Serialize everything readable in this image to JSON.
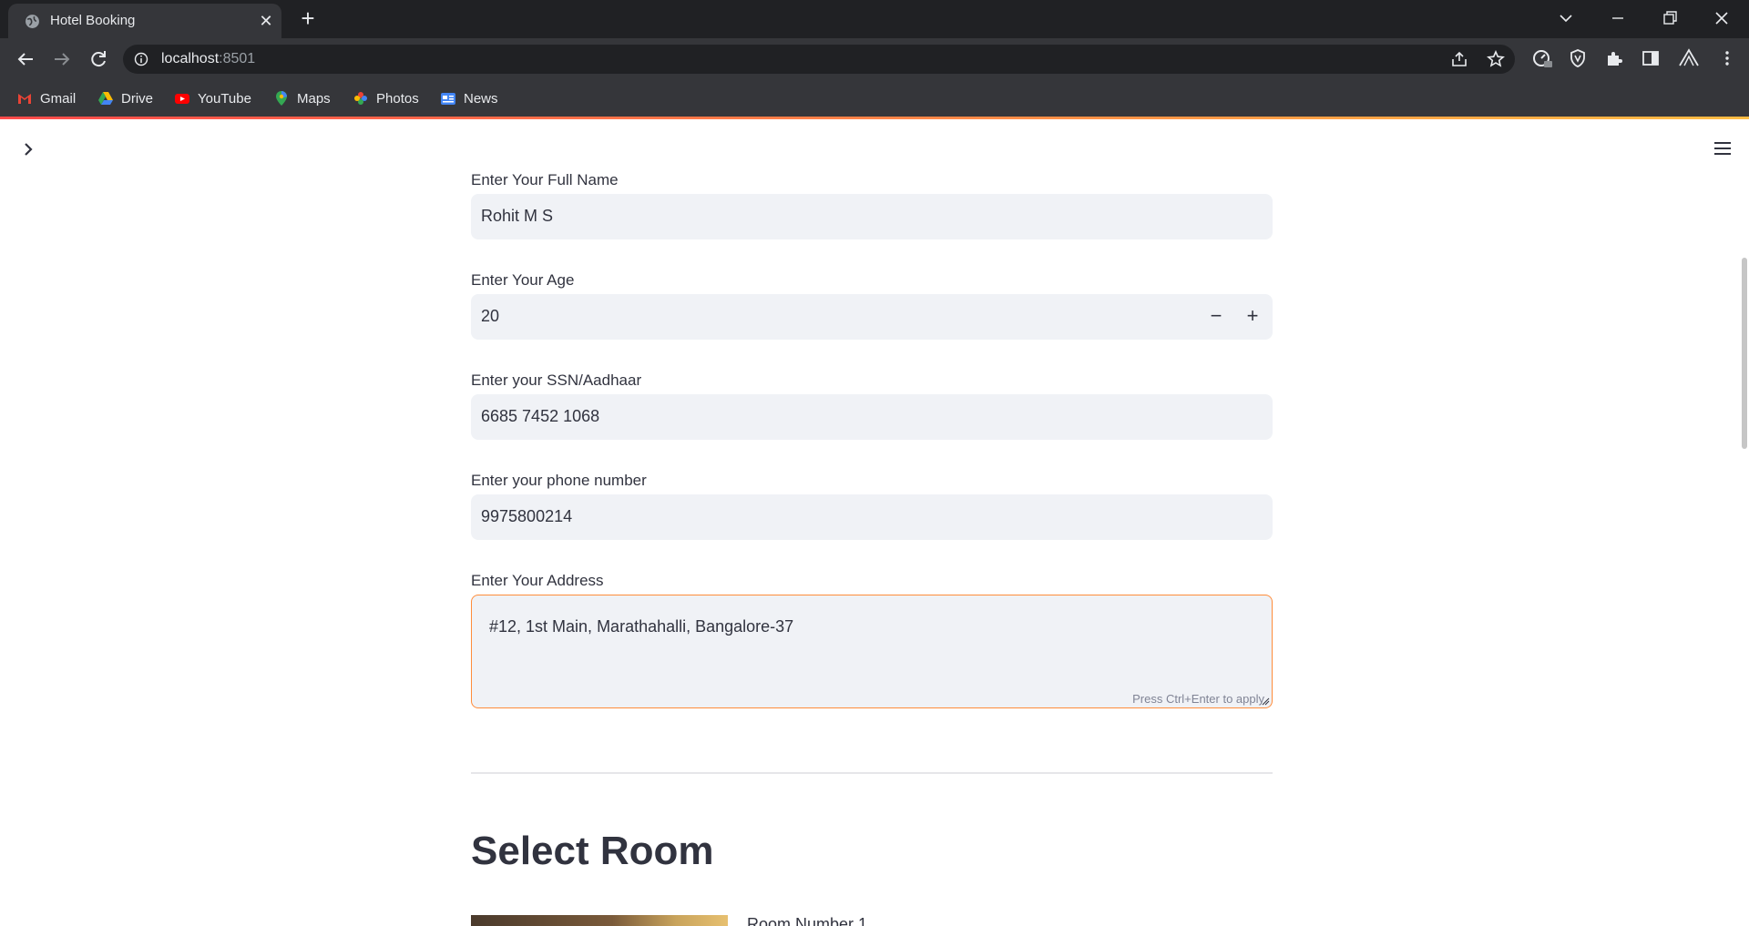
{
  "browser": {
    "tab_title": "Hotel Booking",
    "url_host": "localhost",
    "url_port": ":8501",
    "bookmarks": [
      {
        "label": "Gmail",
        "icon": "gmail-icon"
      },
      {
        "label": "Drive",
        "icon": "drive-icon"
      },
      {
        "label": "YouTube",
        "icon": "youtube-icon"
      },
      {
        "label": "Maps",
        "icon": "maps-icon"
      },
      {
        "label": "Photos",
        "icon": "photos-icon"
      },
      {
        "label": "News",
        "icon": "news-icon"
      }
    ]
  },
  "form": {
    "full_name": {
      "label": "Enter Your Full Name",
      "value": "Rohit M S"
    },
    "age": {
      "label": "Enter Your Age",
      "value": "20",
      "decrement": "−",
      "increment": "+"
    },
    "ssn": {
      "label": "Enter your SSN/Aadhaar",
      "value": "6685 7452 1068"
    },
    "phone": {
      "label": "Enter your phone number",
      "value": "9975800214"
    },
    "address": {
      "label": "Enter Your Address",
      "value": "#12, 1st Main, Marathahalli, Bangalore-37",
      "hint": "Press Ctrl+Enter to apply"
    }
  },
  "section": {
    "heading": "Select Room",
    "room_caption": "Room Number 1"
  },
  "colors": {
    "accent": "#ff8c3a",
    "text": "#31333f",
    "input_bg": "#f0f2f6"
  }
}
